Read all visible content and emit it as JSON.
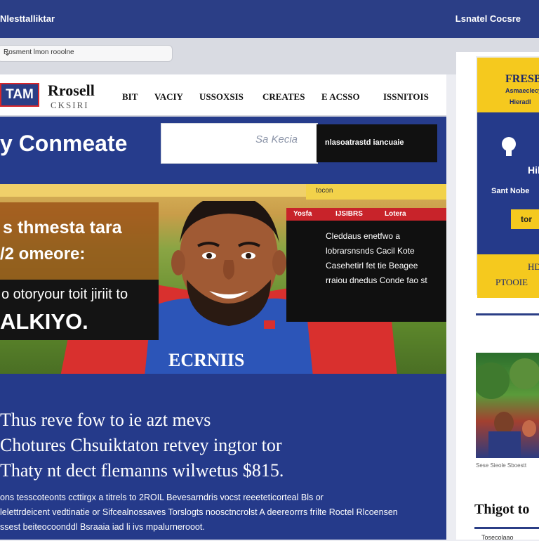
{
  "header": {
    "brand": "Nlesttalliktar",
    "right_link": "Lsnatel Cocsre"
  },
  "filter": {
    "value": "Rosment lmon rooolne",
    "chevron": "chevron-down-icon"
  },
  "site": {
    "logo_badge": "TAM",
    "logo_title": "Rrosell",
    "logo_subtitle": "CKSIRI",
    "nav": [
      "BIT",
      "VACIY",
      "USSOXSIS",
      "CREATES",
      "E ACSSO",
      "ISSNITOIS"
    ]
  },
  "banner": {
    "title": "y Conmeate",
    "search_text": "Sa Kecia",
    "dark_text": "nlasoatrastd iancuaie"
  },
  "hero": {
    "overlay_line1": "s thmesta tara",
    "overlay_line2": "/2 omeore:",
    "overlay_line3": "o otoryour toit jiriit to",
    "overlay_line4": "ALKIYO.",
    "top_strip": "tocon",
    "red_tabs": [
      "Yosfa",
      "IJSIBRS",
      "Lotera"
    ],
    "right_text": "Cleddaus enetfwo a lobrarsnsnds Cacil Kote Casehetirl fet tie Beagee rraiou dnedus Conde fao st",
    "jersey_text": "ECRNIIS"
  },
  "article": {
    "headline": [
      "Thus reve fow to ie azt mevs",
      "Chotures Chsuiktaton retvey ingtor tor",
      "Thaty nt dect flemanns wilwetus $815."
    ],
    "body": [
      "ons tesscoteonts ccttirgx a titrels to 2ROIL Bevesarndris vocst reeeteticorteal Bls or",
      "lelettrdeicent vedtinatie or Sifcealnossaves Torslogts noosctncrolst A deereorrrs frilte Roctel Rlcoensen",
      "ssest beiteocoonddl Bsraaia iad li ivs mpalurnerooot."
    ]
  },
  "sidebar_ad": {
    "title": "FRESB",
    "line2": "Asmaeclecyo",
    "line3": "Hieradl",
    "heading": "Hil",
    "note": "Sant Nobe",
    "button": "tor",
    "bottom1": "HD",
    "bottom2": "PTOOIE"
  },
  "sidebar": {
    "caption": "Sese Sieole Sboestt",
    "heading": "Thigot to",
    "subtext": "Tosecolaao"
  },
  "colors": {
    "navy": "#253a8a",
    "topbar": "#2b3e86",
    "accent_red": "#c8232a",
    "accent_yellow": "#f5c91e"
  }
}
